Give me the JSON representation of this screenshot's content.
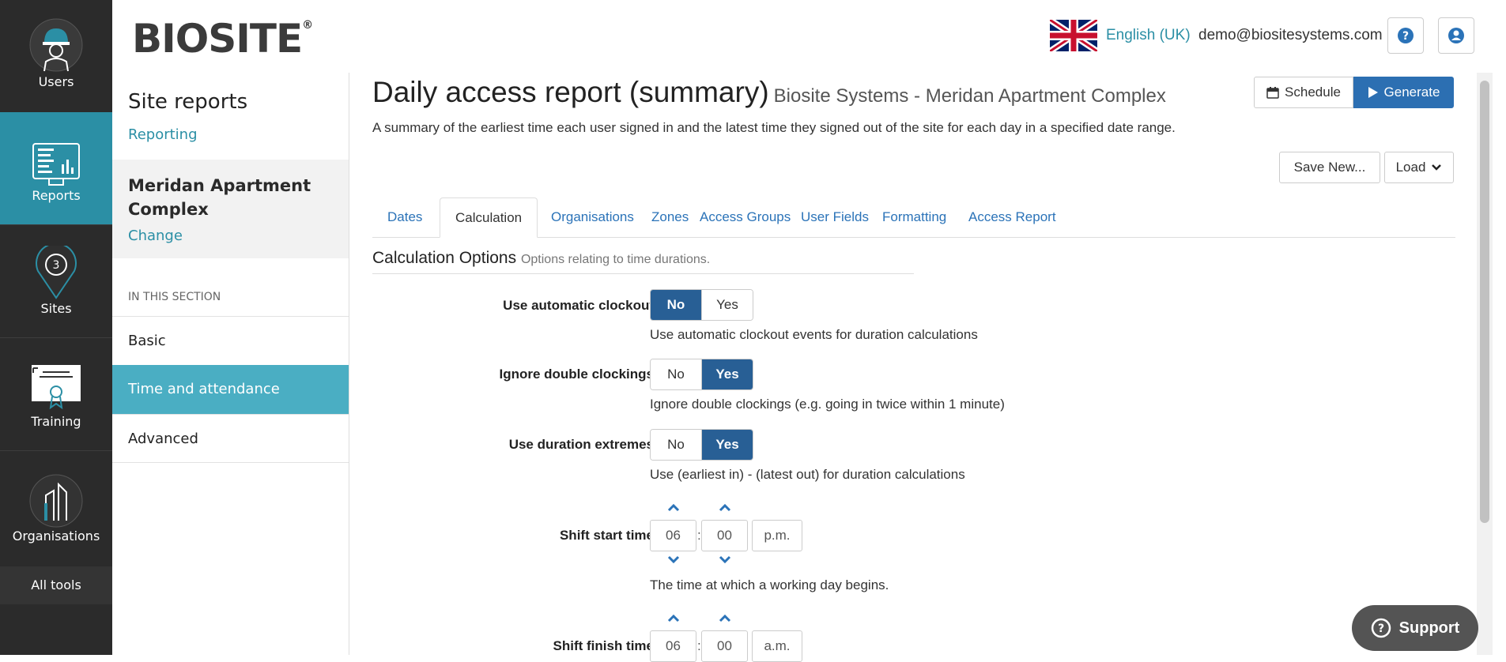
{
  "nav": {
    "items": [
      {
        "label": "Users",
        "icon": "worker-icon"
      },
      {
        "label": "Reports",
        "icon": "reports-icon"
      },
      {
        "label": "Sites",
        "icon": "map-pin-icon"
      },
      {
        "label": "Training",
        "icon": "certificate-icon"
      },
      {
        "label": "Organisations",
        "icon": "buildings-icon"
      }
    ],
    "all_tools": "All tools"
  },
  "header": {
    "logo": "BIOSITE",
    "logo_mark": "®",
    "language": "English (UK)",
    "email": "demo@biositesystems.com",
    "help_icon": "question-circle-icon",
    "account_icon": "user-circle-icon"
  },
  "subnav": {
    "title": "Site reports",
    "breadcrumb": "Reporting",
    "site_name": "Meridan Apartment Complex",
    "change": "Change",
    "section_heading": "IN THIS SECTION",
    "items": [
      "Basic",
      "Time and attendance",
      "Advanced"
    ]
  },
  "main": {
    "title": "Daily access report (summary)",
    "subtitle": "Biosite Systems - Meridan Apartment Complex",
    "description": "A summary of the earliest time each user signed in and the latest time they signed out of the site for each day in a specified date range.",
    "schedule": "Schedule",
    "generate": "Generate",
    "save_new": "Save New...",
    "load": "Load",
    "tabs": [
      "Dates",
      "Calculation",
      "Organisations",
      "Zones",
      "Access Groups",
      "User Fields",
      "Formatting",
      "Access Report"
    ],
    "section_title": "Calculation Options",
    "section_hint": "Options relating to time durations.",
    "options": [
      {
        "label": "Use automatic clockout",
        "no": "No",
        "yes": "Yes",
        "selected": "No",
        "help": "Use automatic clockout events for duration calculations"
      },
      {
        "label": "Ignore double clockings",
        "no": "No",
        "yes": "Yes",
        "selected": "Yes",
        "help": "Ignore double clockings (e.g. going in twice within 1 minute)"
      },
      {
        "label": "Use duration extremes",
        "no": "No",
        "yes": "Yes",
        "selected": "Yes",
        "help": "Use (earliest in) - (latest out) for duration calculations"
      }
    ],
    "shift_start": {
      "label": "Shift start time",
      "hour": "06",
      "minute": "00",
      "period": "p.m.",
      "help": "The time at which a working day begins."
    },
    "shift_finish": {
      "label": "Shift finish time",
      "hour": "06",
      "minute": "00",
      "period": "a.m."
    }
  },
  "support": "Support",
  "colors": {
    "nav_bg": "#2b2b2b",
    "active_nav": "#2b8fa5",
    "active_subnav": "#4aaec3",
    "primary": "#2c6fb2",
    "toggle_on": "#285f95"
  }
}
